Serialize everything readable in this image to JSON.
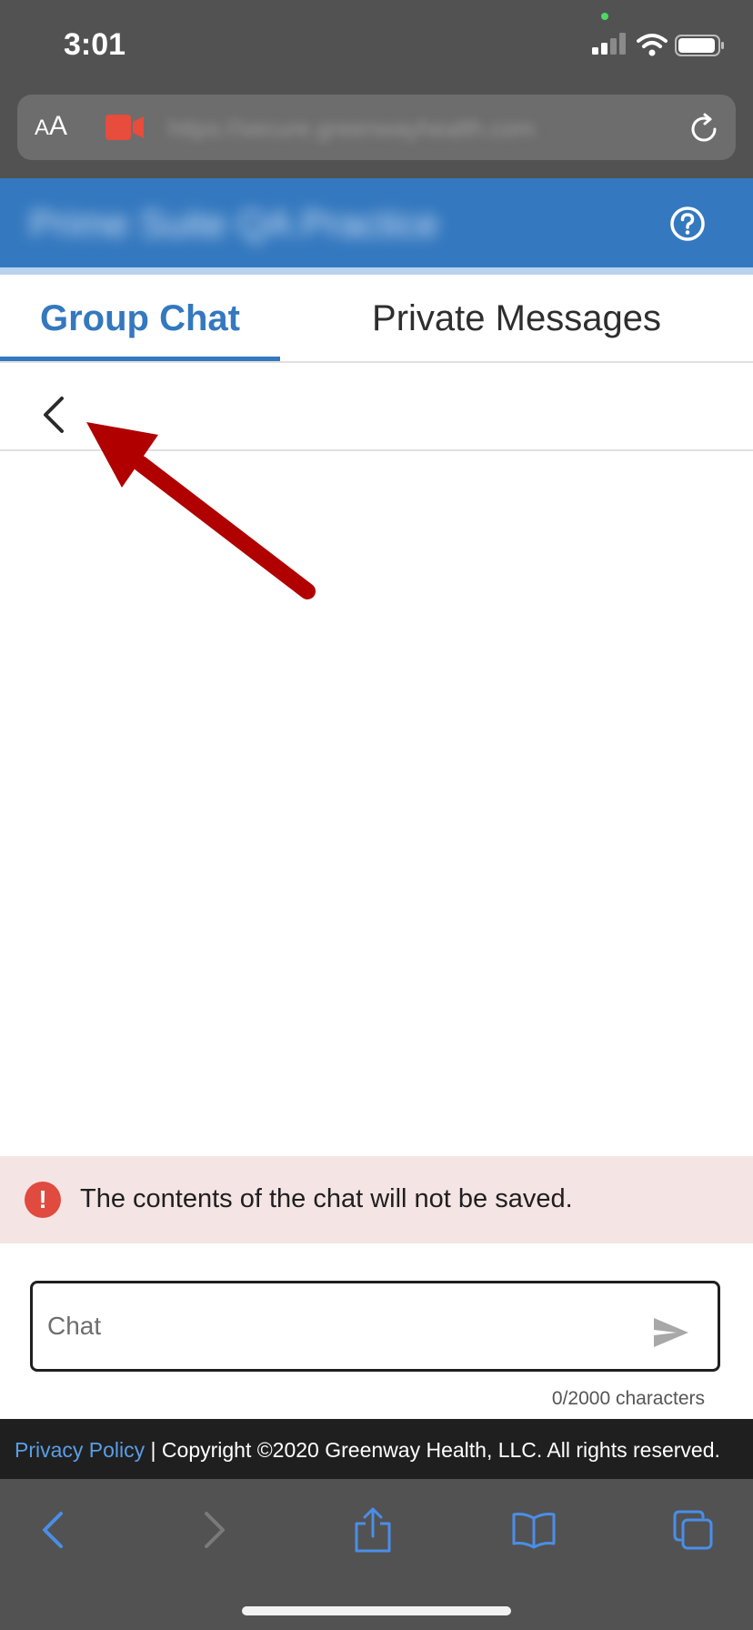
{
  "status_bar": {
    "time": "3:01"
  },
  "browser": {
    "text_size_label_small": "A",
    "text_size_label_large": "A",
    "url_blurred": "https://secure.greenwayhealth.com"
  },
  "app_header": {
    "title_blurred": "Prime Suite QA Practice"
  },
  "tabs": [
    {
      "label": "Group Chat",
      "active": true
    },
    {
      "label": "Private Messages",
      "active": false
    }
  ],
  "warning": {
    "icon_glyph": "!",
    "text": "The contents of the chat will not be saved."
  },
  "chat": {
    "placeholder": "Chat",
    "char_count": "0/2000 characters"
  },
  "footer": {
    "privacy_link": "Privacy Policy",
    "copyright": "| Copyright ©2020 Greenway Health, LLC. All rights reserved."
  },
  "colors": {
    "brand_blue": "#3478bf",
    "warning_bg": "#f5e4e4",
    "warning_icon": "#e04a3f",
    "annotation_arrow": "#b00000"
  },
  "icons": {
    "back": "chevron-left-icon",
    "help": "question-circle-icon",
    "send": "send-icon",
    "annotation": "red-arrow-annotation"
  }
}
